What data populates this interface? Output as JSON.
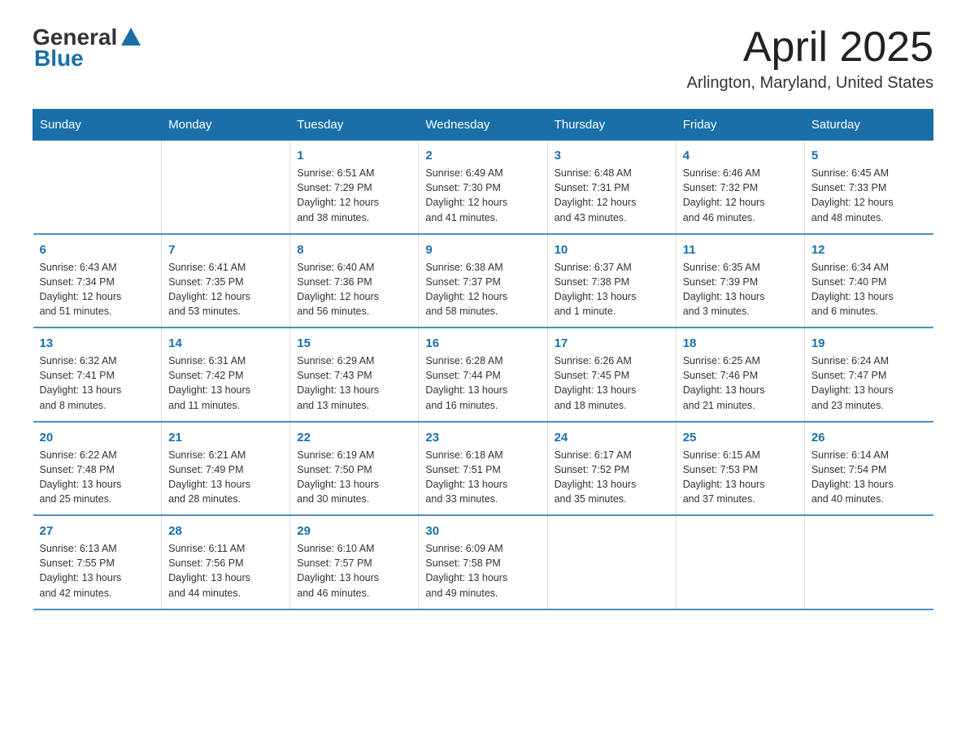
{
  "header": {
    "logo_general": "General",
    "logo_blue": "Blue",
    "title": "April 2025",
    "subtitle": "Arlington, Maryland, United States"
  },
  "days_of_week": [
    "Sunday",
    "Monday",
    "Tuesday",
    "Wednesday",
    "Thursday",
    "Friday",
    "Saturday"
  ],
  "weeks": [
    [
      {
        "day": "",
        "info": ""
      },
      {
        "day": "",
        "info": ""
      },
      {
        "day": "1",
        "info": "Sunrise: 6:51 AM\nSunset: 7:29 PM\nDaylight: 12 hours\nand 38 minutes."
      },
      {
        "day": "2",
        "info": "Sunrise: 6:49 AM\nSunset: 7:30 PM\nDaylight: 12 hours\nand 41 minutes."
      },
      {
        "day": "3",
        "info": "Sunrise: 6:48 AM\nSunset: 7:31 PM\nDaylight: 12 hours\nand 43 minutes."
      },
      {
        "day": "4",
        "info": "Sunrise: 6:46 AM\nSunset: 7:32 PM\nDaylight: 12 hours\nand 46 minutes."
      },
      {
        "day": "5",
        "info": "Sunrise: 6:45 AM\nSunset: 7:33 PM\nDaylight: 12 hours\nand 48 minutes."
      }
    ],
    [
      {
        "day": "6",
        "info": "Sunrise: 6:43 AM\nSunset: 7:34 PM\nDaylight: 12 hours\nand 51 minutes."
      },
      {
        "day": "7",
        "info": "Sunrise: 6:41 AM\nSunset: 7:35 PM\nDaylight: 12 hours\nand 53 minutes."
      },
      {
        "day": "8",
        "info": "Sunrise: 6:40 AM\nSunset: 7:36 PM\nDaylight: 12 hours\nand 56 minutes."
      },
      {
        "day": "9",
        "info": "Sunrise: 6:38 AM\nSunset: 7:37 PM\nDaylight: 12 hours\nand 58 minutes."
      },
      {
        "day": "10",
        "info": "Sunrise: 6:37 AM\nSunset: 7:38 PM\nDaylight: 13 hours\nand 1 minute."
      },
      {
        "day": "11",
        "info": "Sunrise: 6:35 AM\nSunset: 7:39 PM\nDaylight: 13 hours\nand 3 minutes."
      },
      {
        "day": "12",
        "info": "Sunrise: 6:34 AM\nSunset: 7:40 PM\nDaylight: 13 hours\nand 6 minutes."
      }
    ],
    [
      {
        "day": "13",
        "info": "Sunrise: 6:32 AM\nSunset: 7:41 PM\nDaylight: 13 hours\nand 8 minutes."
      },
      {
        "day": "14",
        "info": "Sunrise: 6:31 AM\nSunset: 7:42 PM\nDaylight: 13 hours\nand 11 minutes."
      },
      {
        "day": "15",
        "info": "Sunrise: 6:29 AM\nSunset: 7:43 PM\nDaylight: 13 hours\nand 13 minutes."
      },
      {
        "day": "16",
        "info": "Sunrise: 6:28 AM\nSunset: 7:44 PM\nDaylight: 13 hours\nand 16 minutes."
      },
      {
        "day": "17",
        "info": "Sunrise: 6:26 AM\nSunset: 7:45 PM\nDaylight: 13 hours\nand 18 minutes."
      },
      {
        "day": "18",
        "info": "Sunrise: 6:25 AM\nSunset: 7:46 PM\nDaylight: 13 hours\nand 21 minutes."
      },
      {
        "day": "19",
        "info": "Sunrise: 6:24 AM\nSunset: 7:47 PM\nDaylight: 13 hours\nand 23 minutes."
      }
    ],
    [
      {
        "day": "20",
        "info": "Sunrise: 6:22 AM\nSunset: 7:48 PM\nDaylight: 13 hours\nand 25 minutes."
      },
      {
        "day": "21",
        "info": "Sunrise: 6:21 AM\nSunset: 7:49 PM\nDaylight: 13 hours\nand 28 minutes."
      },
      {
        "day": "22",
        "info": "Sunrise: 6:19 AM\nSunset: 7:50 PM\nDaylight: 13 hours\nand 30 minutes."
      },
      {
        "day": "23",
        "info": "Sunrise: 6:18 AM\nSunset: 7:51 PM\nDaylight: 13 hours\nand 33 minutes."
      },
      {
        "day": "24",
        "info": "Sunrise: 6:17 AM\nSunset: 7:52 PM\nDaylight: 13 hours\nand 35 minutes."
      },
      {
        "day": "25",
        "info": "Sunrise: 6:15 AM\nSunset: 7:53 PM\nDaylight: 13 hours\nand 37 minutes."
      },
      {
        "day": "26",
        "info": "Sunrise: 6:14 AM\nSunset: 7:54 PM\nDaylight: 13 hours\nand 40 minutes."
      }
    ],
    [
      {
        "day": "27",
        "info": "Sunrise: 6:13 AM\nSunset: 7:55 PM\nDaylight: 13 hours\nand 42 minutes."
      },
      {
        "day": "28",
        "info": "Sunrise: 6:11 AM\nSunset: 7:56 PM\nDaylight: 13 hours\nand 44 minutes."
      },
      {
        "day": "29",
        "info": "Sunrise: 6:10 AM\nSunset: 7:57 PM\nDaylight: 13 hours\nand 46 minutes."
      },
      {
        "day": "30",
        "info": "Sunrise: 6:09 AM\nSunset: 7:58 PM\nDaylight: 13 hours\nand 49 minutes."
      },
      {
        "day": "",
        "info": ""
      },
      {
        "day": "",
        "info": ""
      },
      {
        "day": "",
        "info": ""
      }
    ]
  ]
}
